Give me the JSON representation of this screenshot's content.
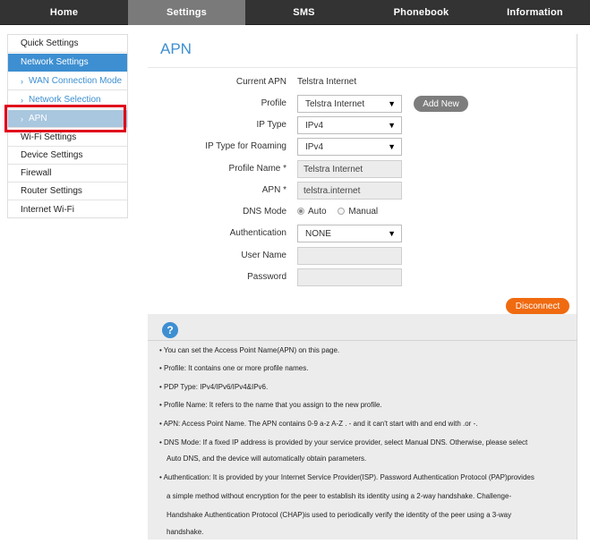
{
  "nav": {
    "tabs": [
      {
        "label": "Home"
      },
      {
        "label": "Settings"
      },
      {
        "label": "SMS"
      },
      {
        "label": "Phonebook"
      },
      {
        "label": "Information"
      }
    ],
    "active_index": 1
  },
  "sidebar": {
    "items": [
      {
        "label": "Quick Settings"
      },
      {
        "label": "Network Settings"
      },
      {
        "label": "WAN Connection Mode"
      },
      {
        "label": "Network Selection"
      },
      {
        "label": "APN"
      },
      {
        "label": "Wi-Fi Settings"
      },
      {
        "label": "Device Settings"
      },
      {
        "label": "Firewall"
      },
      {
        "label": "Router Settings"
      },
      {
        "label": "Internet Wi-Fi"
      }
    ],
    "chevron": "›"
  },
  "page": {
    "title": "APN"
  },
  "form": {
    "current_apn_label": "Current APN",
    "current_apn_value": "Telstra Internet",
    "profile_label": "Profile",
    "profile_value": "Telstra Internet",
    "add_new_label": "Add New",
    "ip_type_label": "IP Type",
    "ip_type_value": "IPv4",
    "ip_type_roaming_label": "IP Type for Roaming",
    "ip_type_roaming_value": "IPv4",
    "profile_name_label": "Profile Name *",
    "profile_name_value": "Telstra Internet",
    "apn_label": "APN *",
    "apn_value": "telstra.internet",
    "dns_mode_label": "DNS Mode",
    "dns_auto": "Auto",
    "dns_manual": "Manual",
    "authentication_label": "Authentication",
    "authentication_value": "NONE",
    "user_name_label": "User Name",
    "user_name_value": "",
    "password_label": "Password",
    "password_value": "",
    "disconnect_label": "Disconnect",
    "select_arrow": "▼"
  },
  "help": {
    "icon": "?",
    "lines": [
      "• You can set the Access Point Name(APN) on this page.",
      "• Profile: It contains one or more profile names.",
      "• PDP Type: IPv4/IPv6/IPv4&IPv6.",
      "• Profile Name: It refers to the name that you assign to the new profile.",
      "• APN: Access Point Name. The APN contains 0-9 a-z A-Z . - and it can't start with and end with .or -.",
      "• DNS Mode: If a fixed IP address is provided by your service provider, select Manual DNS. Otherwise, please select",
      "Auto DNS, and the device will automatically obtain parameters.",
      "• Authentication: It is provided by your Internet Service Provider(ISP). Password Authentication Protocol (PAP)provides",
      "a simple method without encryption for the peer to establish its identity using a 2-way handshake. Challenge-",
      "Handshake Authentication Protocol (CHAP)is used to periodically verify the identity of the peer using a 3-way",
      "handshake."
    ]
  },
  "colors": {
    "accent": "#3d8fd1",
    "nav_bg": "#333333",
    "nav_active": "#7a7a7a",
    "highlight_box": "#e0001b",
    "disconnect": "#f06a10"
  }
}
